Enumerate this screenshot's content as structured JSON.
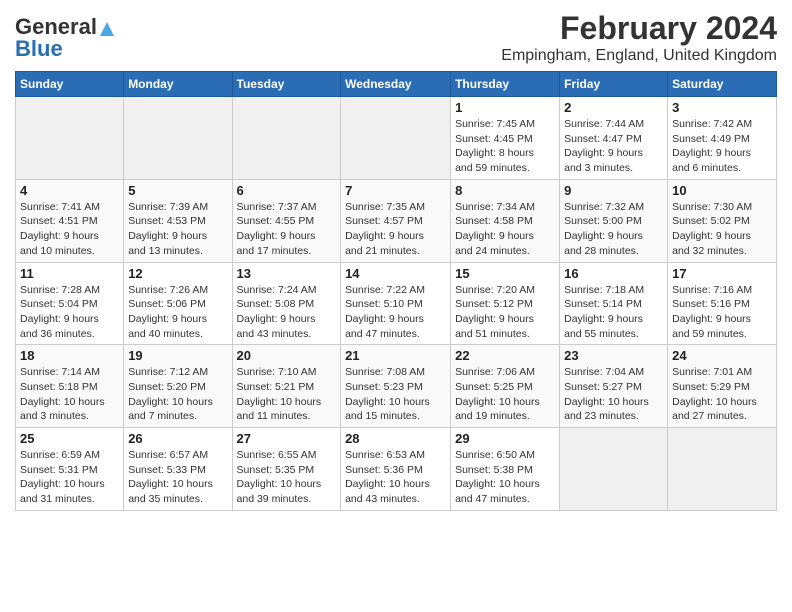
{
  "header": {
    "logo_general": "General",
    "logo_blue": "Blue",
    "title": "February 2024",
    "subtitle": "Empingham, England, United Kingdom"
  },
  "calendar": {
    "days_of_week": [
      "Sunday",
      "Monday",
      "Tuesday",
      "Wednesday",
      "Thursday",
      "Friday",
      "Saturday"
    ],
    "weeks": [
      [
        {
          "day": "",
          "info": ""
        },
        {
          "day": "",
          "info": ""
        },
        {
          "day": "",
          "info": ""
        },
        {
          "day": "",
          "info": ""
        },
        {
          "day": "1",
          "info": "Sunrise: 7:45 AM\nSunset: 4:45 PM\nDaylight: 8 hours\nand 59 minutes."
        },
        {
          "day": "2",
          "info": "Sunrise: 7:44 AM\nSunset: 4:47 PM\nDaylight: 9 hours\nand 3 minutes."
        },
        {
          "day": "3",
          "info": "Sunrise: 7:42 AM\nSunset: 4:49 PM\nDaylight: 9 hours\nand 6 minutes."
        }
      ],
      [
        {
          "day": "4",
          "info": "Sunrise: 7:41 AM\nSunset: 4:51 PM\nDaylight: 9 hours\nand 10 minutes."
        },
        {
          "day": "5",
          "info": "Sunrise: 7:39 AM\nSunset: 4:53 PM\nDaylight: 9 hours\nand 13 minutes."
        },
        {
          "day": "6",
          "info": "Sunrise: 7:37 AM\nSunset: 4:55 PM\nDaylight: 9 hours\nand 17 minutes."
        },
        {
          "day": "7",
          "info": "Sunrise: 7:35 AM\nSunset: 4:57 PM\nDaylight: 9 hours\nand 21 minutes."
        },
        {
          "day": "8",
          "info": "Sunrise: 7:34 AM\nSunset: 4:58 PM\nDaylight: 9 hours\nand 24 minutes."
        },
        {
          "day": "9",
          "info": "Sunrise: 7:32 AM\nSunset: 5:00 PM\nDaylight: 9 hours\nand 28 minutes."
        },
        {
          "day": "10",
          "info": "Sunrise: 7:30 AM\nSunset: 5:02 PM\nDaylight: 9 hours\nand 32 minutes."
        }
      ],
      [
        {
          "day": "11",
          "info": "Sunrise: 7:28 AM\nSunset: 5:04 PM\nDaylight: 9 hours\nand 36 minutes."
        },
        {
          "day": "12",
          "info": "Sunrise: 7:26 AM\nSunset: 5:06 PM\nDaylight: 9 hours\nand 40 minutes."
        },
        {
          "day": "13",
          "info": "Sunrise: 7:24 AM\nSunset: 5:08 PM\nDaylight: 9 hours\nand 43 minutes."
        },
        {
          "day": "14",
          "info": "Sunrise: 7:22 AM\nSunset: 5:10 PM\nDaylight: 9 hours\nand 47 minutes."
        },
        {
          "day": "15",
          "info": "Sunrise: 7:20 AM\nSunset: 5:12 PM\nDaylight: 9 hours\nand 51 minutes."
        },
        {
          "day": "16",
          "info": "Sunrise: 7:18 AM\nSunset: 5:14 PM\nDaylight: 9 hours\nand 55 minutes."
        },
        {
          "day": "17",
          "info": "Sunrise: 7:16 AM\nSunset: 5:16 PM\nDaylight: 9 hours\nand 59 minutes."
        }
      ],
      [
        {
          "day": "18",
          "info": "Sunrise: 7:14 AM\nSunset: 5:18 PM\nDaylight: 10 hours\nand 3 minutes."
        },
        {
          "day": "19",
          "info": "Sunrise: 7:12 AM\nSunset: 5:20 PM\nDaylight: 10 hours\nand 7 minutes."
        },
        {
          "day": "20",
          "info": "Sunrise: 7:10 AM\nSunset: 5:21 PM\nDaylight: 10 hours\nand 11 minutes."
        },
        {
          "day": "21",
          "info": "Sunrise: 7:08 AM\nSunset: 5:23 PM\nDaylight: 10 hours\nand 15 minutes."
        },
        {
          "day": "22",
          "info": "Sunrise: 7:06 AM\nSunset: 5:25 PM\nDaylight: 10 hours\nand 19 minutes."
        },
        {
          "day": "23",
          "info": "Sunrise: 7:04 AM\nSunset: 5:27 PM\nDaylight: 10 hours\nand 23 minutes."
        },
        {
          "day": "24",
          "info": "Sunrise: 7:01 AM\nSunset: 5:29 PM\nDaylight: 10 hours\nand 27 minutes."
        }
      ],
      [
        {
          "day": "25",
          "info": "Sunrise: 6:59 AM\nSunset: 5:31 PM\nDaylight: 10 hours\nand 31 minutes."
        },
        {
          "day": "26",
          "info": "Sunrise: 6:57 AM\nSunset: 5:33 PM\nDaylight: 10 hours\nand 35 minutes."
        },
        {
          "day": "27",
          "info": "Sunrise: 6:55 AM\nSunset: 5:35 PM\nDaylight: 10 hours\nand 39 minutes."
        },
        {
          "day": "28",
          "info": "Sunrise: 6:53 AM\nSunset: 5:36 PM\nDaylight: 10 hours\nand 43 minutes."
        },
        {
          "day": "29",
          "info": "Sunrise: 6:50 AM\nSunset: 5:38 PM\nDaylight: 10 hours\nand 47 minutes."
        },
        {
          "day": "",
          "info": ""
        },
        {
          "day": "",
          "info": ""
        }
      ]
    ]
  }
}
